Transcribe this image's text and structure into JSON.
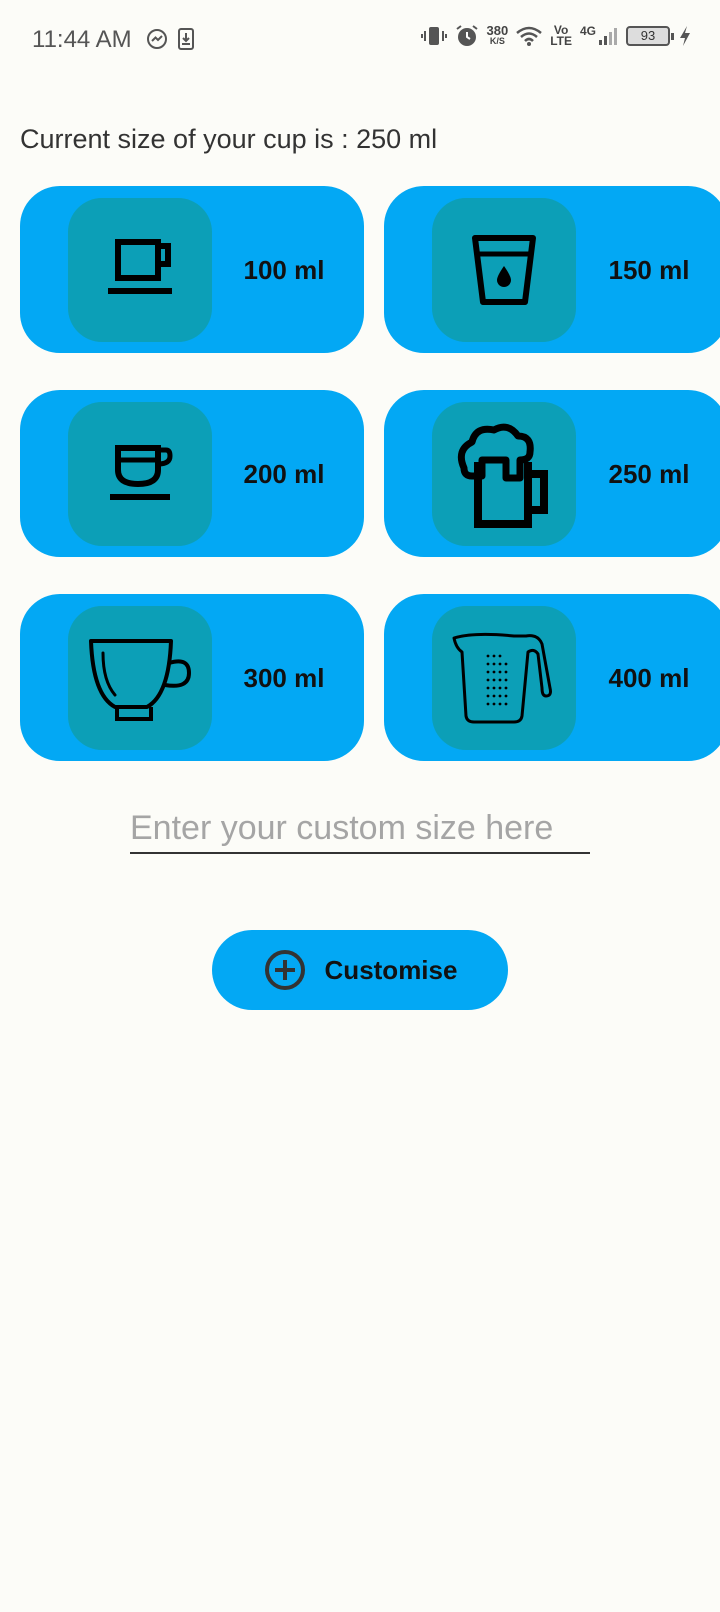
{
  "status_bar": {
    "time": "11:44 AM",
    "speed_value": "380",
    "speed_unit": "K/S",
    "volte_top": "Vo",
    "volte_bottom": "LTE",
    "network": "4G",
    "battery": "93"
  },
  "current_size_text": "Current size of your cup is : 250 ml",
  "cups": [
    {
      "label": "100 ml",
      "icon": "coffee-cup-saucer-icon"
    },
    {
      "label": "150 ml",
      "icon": "water-glass-icon"
    },
    {
      "label": "200 ml",
      "icon": "espresso-cup-icon"
    },
    {
      "label": "250 ml",
      "icon": "beer-mug-icon"
    },
    {
      "label": "300 ml",
      "icon": "tea-cup-icon"
    },
    {
      "label": "400 ml",
      "icon": "measuring-jug-icon"
    }
  ],
  "custom_input": {
    "placeholder": "Enter your custom size here",
    "value": ""
  },
  "customise_button": {
    "label": "Customise",
    "icon": "add-circle-icon"
  },
  "colors": {
    "accent": "#03a8f4",
    "icon_bg": "#0c9fb7",
    "background": "#fcfcf8"
  }
}
